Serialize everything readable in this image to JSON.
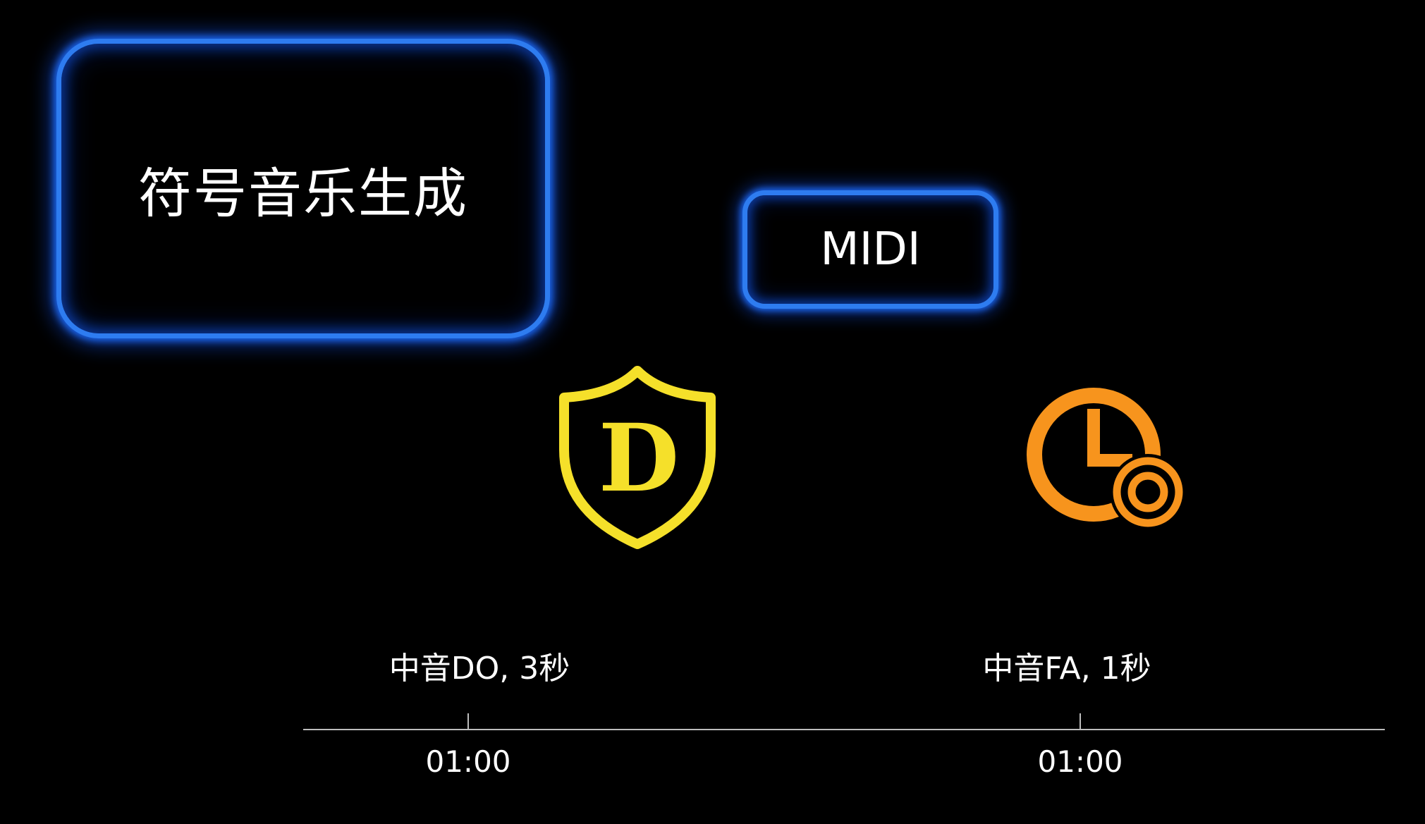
{
  "title_box": {
    "label": "符号音乐生成"
  },
  "format_box": {
    "label": "MIDI"
  },
  "icons": {
    "shield": {
      "name": "shield-d-icon",
      "letter": "D",
      "color": "#f5e02a"
    },
    "clock": {
      "name": "clock-icon",
      "color": "#f7941d"
    }
  },
  "events": [
    {
      "label": "中音DO, 3秒",
      "time": "01:00"
    },
    {
      "label": "中音FA, 1秒",
      "time": "01:00"
    }
  ],
  "colors": {
    "background": "#000000",
    "box_border": "#2e7cf0",
    "timeline": "#bdbdbd"
  }
}
